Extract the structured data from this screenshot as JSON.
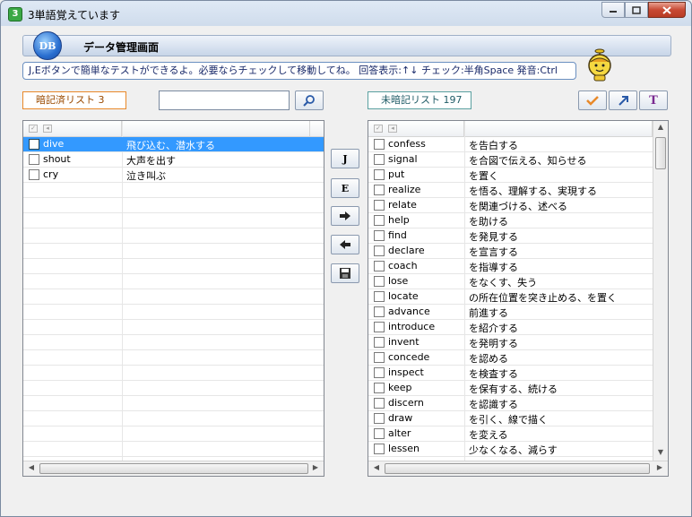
{
  "window": {
    "title": "3単語覚えています",
    "app_icon": "app-icon",
    "controls": [
      "minimize",
      "maximize",
      "close"
    ]
  },
  "header": {
    "logo": "DB",
    "title": "データ管理画面"
  },
  "tip": "J,Eボタンで簡単なテストができるよ。必要ならチェックして移動してね。 回答表示:↑↓ チェック:半角Space 発音:Ctrl",
  "learned": {
    "tag_label": "暗記済リスト 3",
    "search_value": "",
    "rows": [
      {
        "en": "dive",
        "jp": "飛び込む、潜水する",
        "selected": true
      },
      {
        "en": "shout",
        "jp": "大声を出す",
        "selected": false
      },
      {
        "en": "cry",
        "jp": "泣き叫ぶ",
        "selected": false
      }
    ]
  },
  "unlearned": {
    "tag_label": "未暗記リスト 197",
    "rows": [
      {
        "en": "confess",
        "jp": "を告白する"
      },
      {
        "en": "signal",
        "jp": "を合図で伝える、知らせる"
      },
      {
        "en": "put",
        "jp": "を置く"
      },
      {
        "en": "realize",
        "jp": "を悟る、理解する、実現する"
      },
      {
        "en": "relate",
        "jp": "を関連づける、述べる"
      },
      {
        "en": "help",
        "jp": "を助ける"
      },
      {
        "en": "find",
        "jp": "を発見する"
      },
      {
        "en": "declare",
        "jp": "を宣言する"
      },
      {
        "en": "coach",
        "jp": "を指導する"
      },
      {
        "en": "lose",
        "jp": "をなくす、失う"
      },
      {
        "en": "locate",
        "jp": "の所在位置を突き止める、を置く"
      },
      {
        "en": "advance",
        "jp": "前進する"
      },
      {
        "en": "introduce",
        "jp": "を紹介する"
      },
      {
        "en": "invent",
        "jp": "を発明する"
      },
      {
        "en": "concede",
        "jp": "を認める"
      },
      {
        "en": "inspect",
        "jp": "を検査する"
      },
      {
        "en": "keep",
        "jp": "を保有する、続ける"
      },
      {
        "en": "discern",
        "jp": "を認識する"
      },
      {
        "en": "draw",
        "jp": "を引く、線で描く"
      },
      {
        "en": "alter",
        "jp": "を変える"
      },
      {
        "en": "lessen",
        "jp": "少なくなる、減らす"
      }
    ]
  },
  "middle_buttons": [
    {
      "name": "test-j-button",
      "label": "J",
      "icon": ""
    },
    {
      "name": "test-e-button",
      "label": "E",
      "icon": ""
    },
    {
      "name": "move-right-button",
      "label": "",
      "icon": "arrow-right-icon"
    },
    {
      "name": "move-left-button",
      "label": "",
      "icon": "arrow-left-icon"
    },
    {
      "name": "save-button",
      "label": "",
      "icon": "floppy-icon"
    }
  ],
  "toolbar": {
    "check_icon": "check-icon",
    "export_icon": "export-arrow-icon",
    "font_icon": "font-color-icon",
    "font_label": "T"
  },
  "colors": {
    "selection": "#3399ff",
    "learned_tag_border": "#e8892a",
    "unlearned_tag_border": "#5aa0a0"
  }
}
